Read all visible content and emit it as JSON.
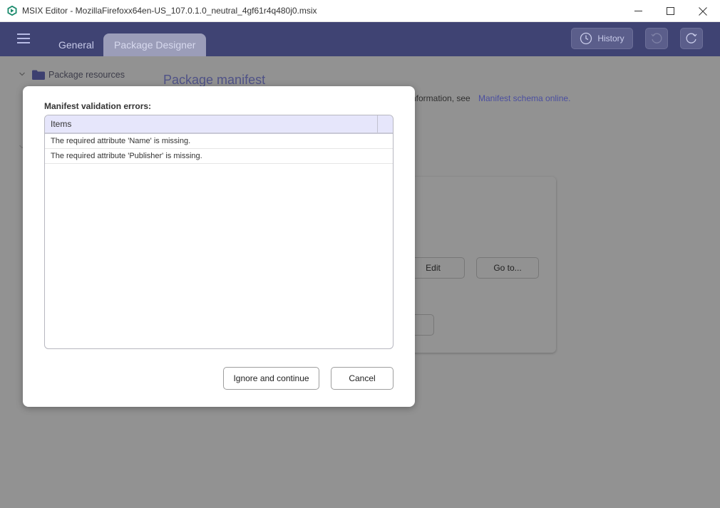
{
  "window": {
    "title": "MSIX Editor - MozillaFirefoxx64en-US_107.0.1.0_neutral_4gf61r4q480j0.msix",
    "app_icon": "msix-logo-icon"
  },
  "header": {
    "tabs": [
      {
        "label": "General"
      },
      {
        "label": "Package Designer",
        "active": true
      }
    ],
    "history_label": "History",
    "colors": {
      "header_bg": "#3f4373",
      "active_tab_bg": "#9b9db9"
    }
  },
  "sidebar": {
    "package_resources_label": "Package resources"
  },
  "content": {
    "title": "Package manifest",
    "description_fragment": "nformation, see",
    "schema_link": "Manifest schema online.",
    "edit_label": "Edit",
    "goto_label": "Go to..."
  },
  "dialog": {
    "label": "Manifest validation errors:",
    "column_header": "Items",
    "errors": [
      "The required attribute 'Name' is missing.",
      "The required attribute 'Publisher' is missing."
    ],
    "ignore_label": "Ignore and continue",
    "cancel_label": "Cancel"
  }
}
